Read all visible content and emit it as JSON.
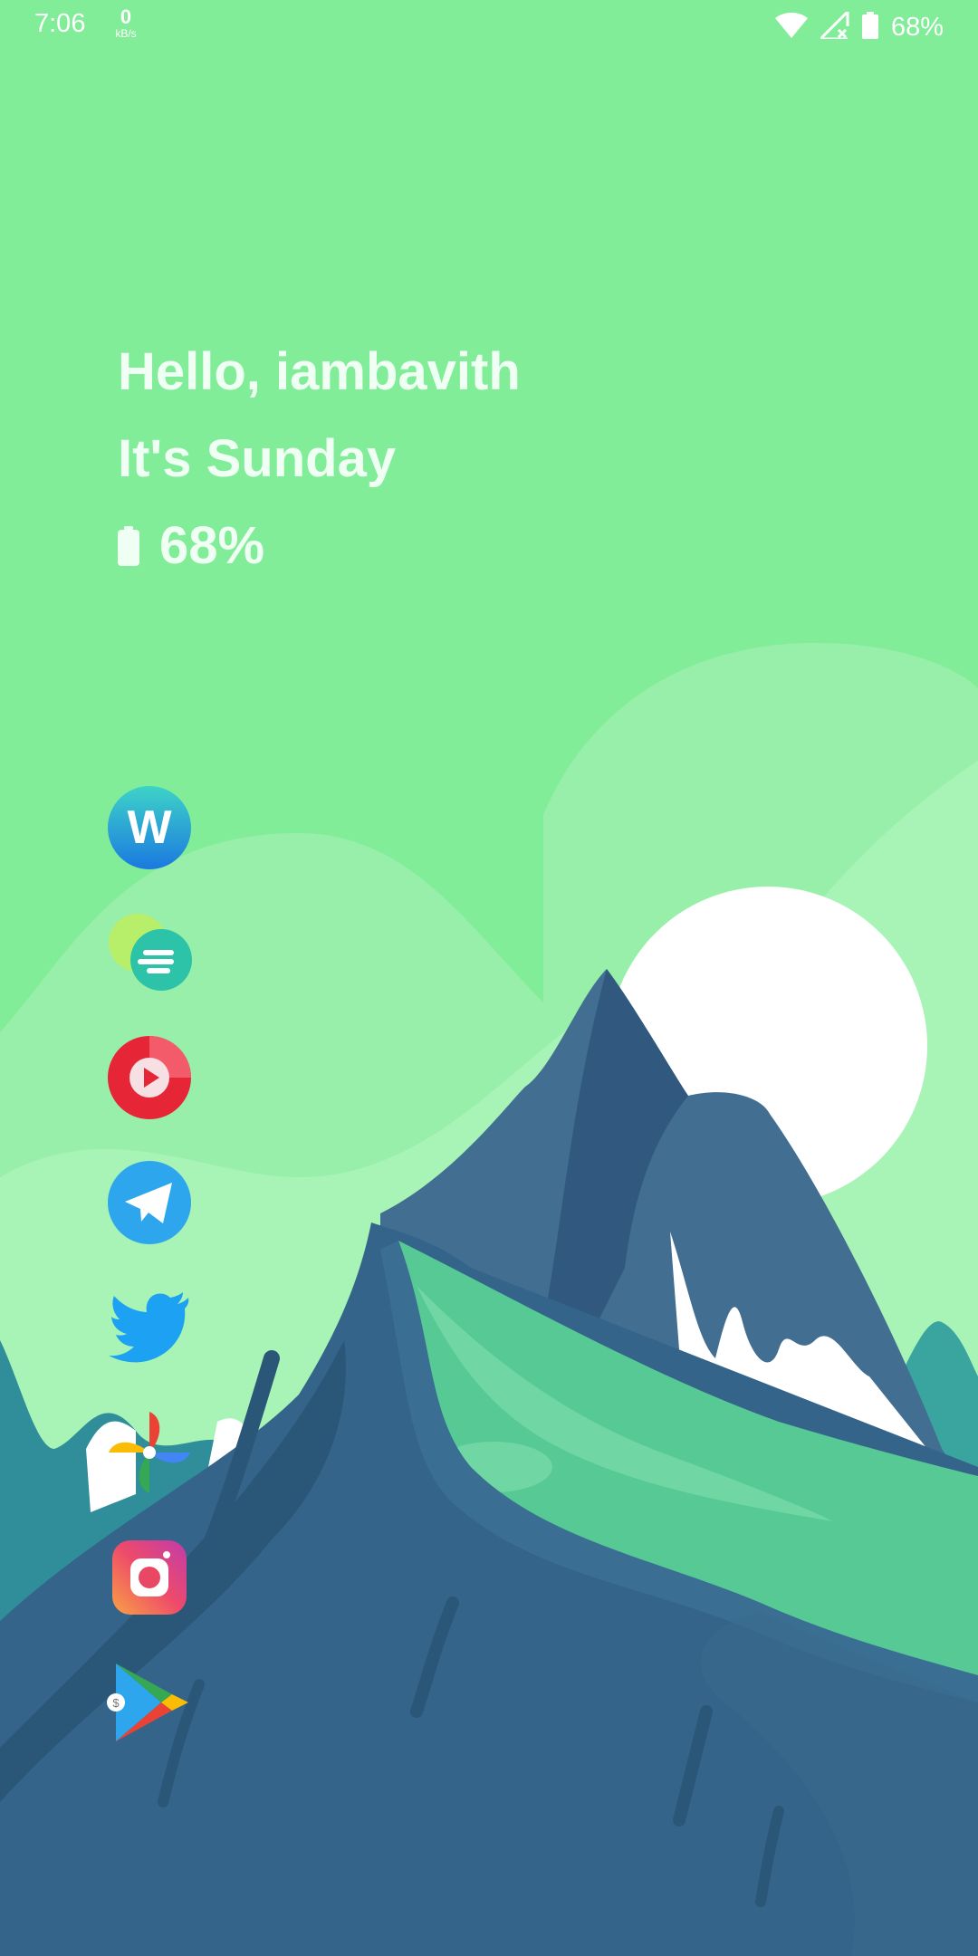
{
  "status_bar": {
    "time": "7:06",
    "net_speed_value": "0",
    "net_speed_unit": "kB/s",
    "battery_text": "68%",
    "icons": [
      "wifi-icon",
      "no-signal-icon",
      "battery-icon"
    ]
  },
  "widget": {
    "greeting": "Hello, iambavith",
    "day": "It's Sunday",
    "battery": "68%"
  },
  "apps": [
    {
      "name": "wattpad-icon"
    },
    {
      "name": "messages-icon"
    },
    {
      "name": "music-player-icon"
    },
    {
      "name": "telegram-icon"
    },
    {
      "name": "twitter-icon"
    },
    {
      "name": "pinwheel-icon"
    },
    {
      "name": "instagram-icon"
    },
    {
      "name": "play-store-icon"
    }
  ],
  "colors": {
    "sky": "#82ED98",
    "sun": "#FFFFFF",
    "mountain_dark": "#2D5C7F",
    "meadow": "#56C994"
  }
}
